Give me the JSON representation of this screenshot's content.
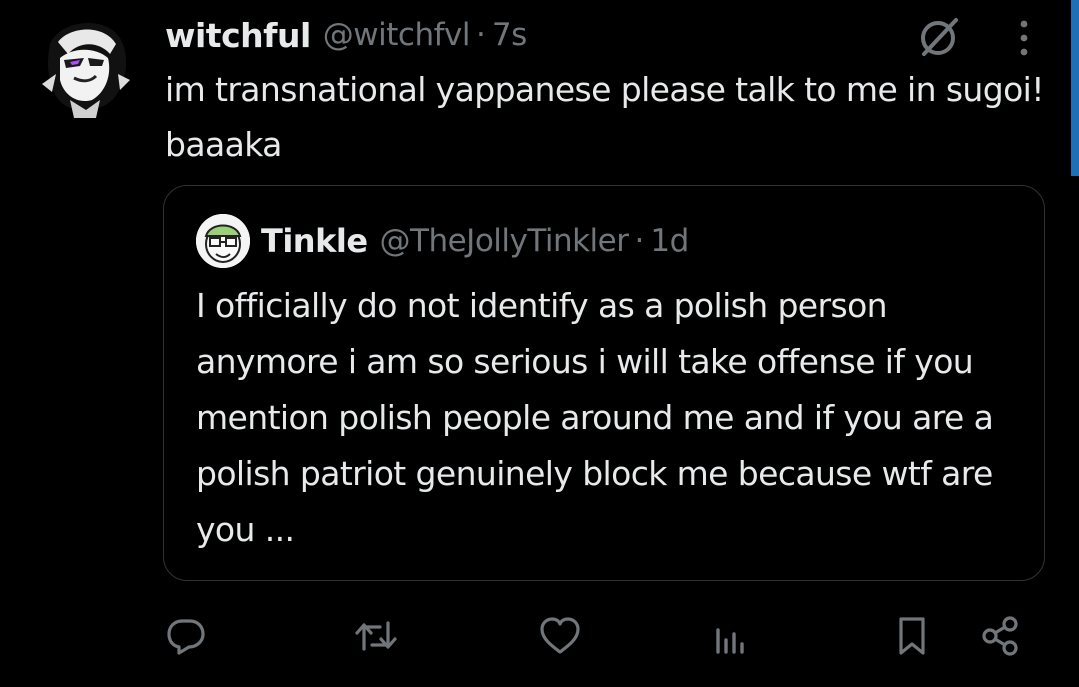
{
  "tweet": {
    "display_name": "witchful",
    "handle": "@witchfvl",
    "separator": "·",
    "time": "7s",
    "text": "im transnational yappanese please talk to me in sugoi! baaaka"
  },
  "quoted_tweet": {
    "display_name": "Tinkle",
    "handle": "@TheJollyTinkler",
    "separator": "·",
    "time": "1d",
    "text": "I officially do not identify as a polish person anymore i am so serious i will take offense if you mention polish people around me and if you are a polish patriot genuinely block me because wtf are you ..."
  },
  "actions": [
    "reply-icon",
    "retweet-icon",
    "like-icon",
    "views-icon",
    "bookmark-icon",
    "share-icon"
  ],
  "colors": {
    "background": "#000000",
    "text_primary": "#e7e9ea",
    "text_secondary": "#71767b",
    "border": "#2f3336",
    "scroll_accent": "#1d6fb8",
    "avatar_accent": "#b04cff"
  }
}
